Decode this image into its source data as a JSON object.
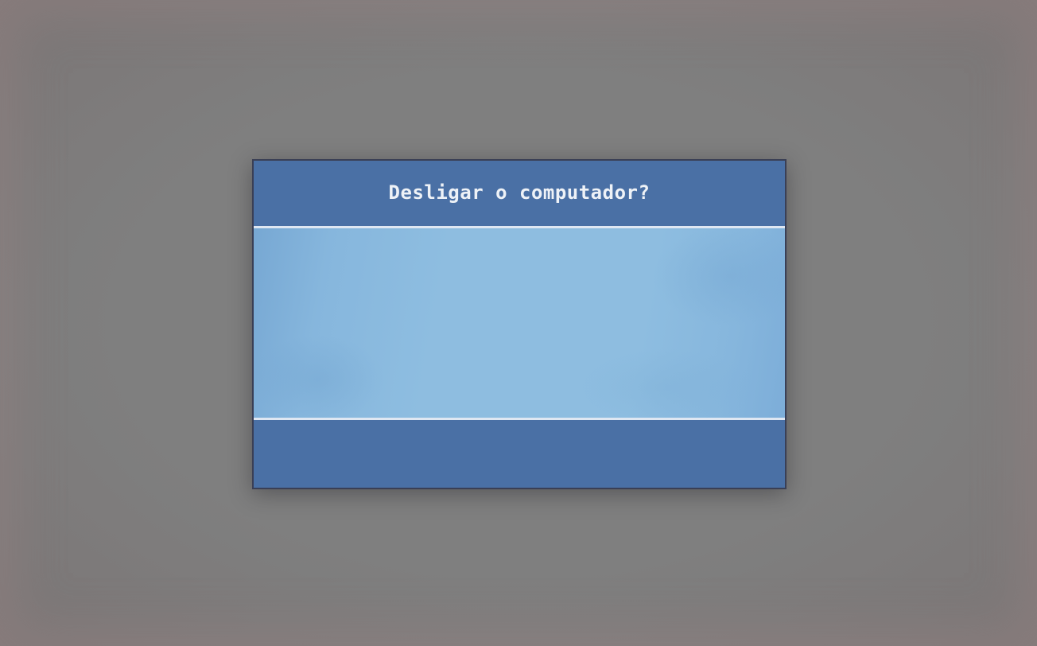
{
  "dialog": {
    "title": "Desligar o computador?"
  }
}
